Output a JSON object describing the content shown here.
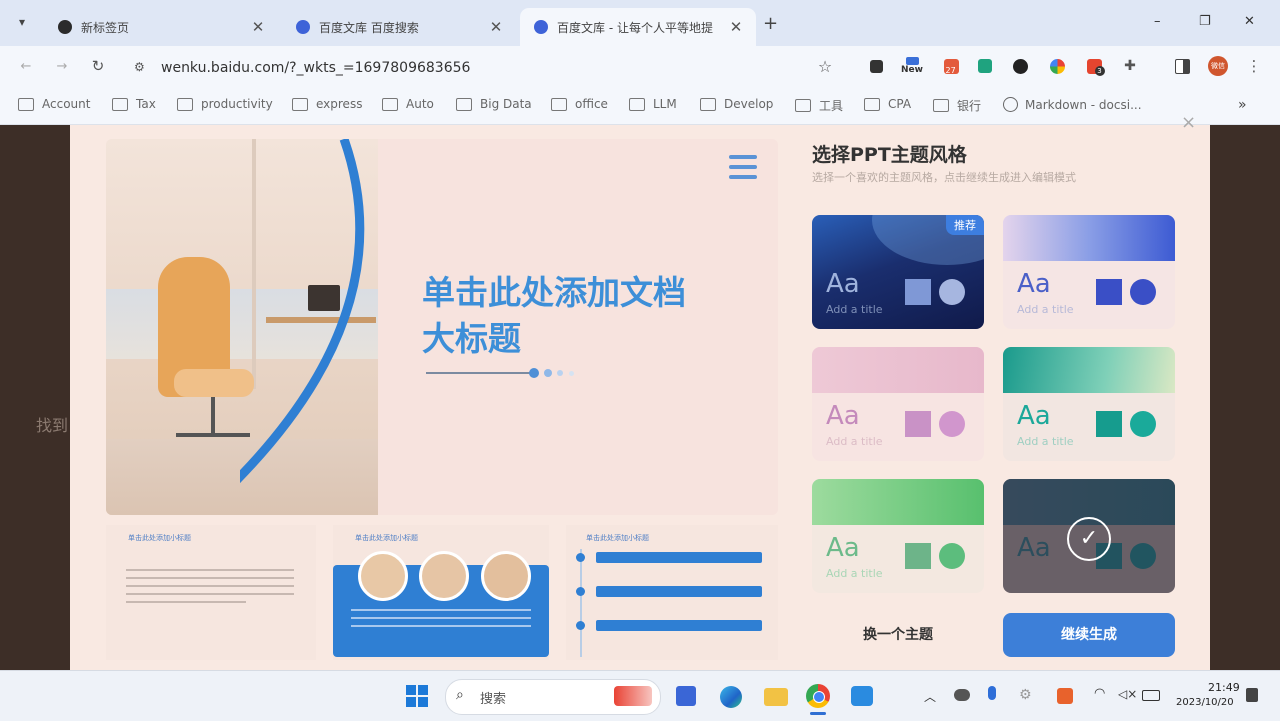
{
  "browser": {
    "tabs": [
      {
        "title": "新标签页",
        "active": false
      },
      {
        "title": "百度文库 百度搜索",
        "active": false
      },
      {
        "title": "百度文库 - 让每个人平等地提",
        "active": true
      }
    ],
    "new_tab_symbol": "+",
    "window_controls": [
      "–",
      "❐",
      "✕"
    ],
    "url": "wenku.baidu.com/?_wkts_=1697809683656",
    "extension_badges": {
      "new": "New",
      "count27": "27",
      "count3": "3"
    },
    "profile_initials": "微信"
  },
  "bookmarks": [
    "Account",
    "Tax",
    "productivity",
    "express",
    "Auto",
    "Big Data",
    "office",
    "LLM",
    "Develop",
    "工具",
    "CPA",
    "银行",
    "Markdown - docsi..."
  ],
  "bookmarks_more": "»",
  "slide": {
    "title_line1": "单击此处添加文档",
    "title_line2": "大标题"
  },
  "panel": {
    "close": "×",
    "title": "选择PPT主题风格",
    "subtitle": "选择一个喜欢的主题风格，点击继续生成进入编辑模式",
    "recommend_badge": "推荐",
    "themes": [
      {
        "aa": "Aa",
        "sub": "Add a title",
        "accent": "#5b78c6"
      },
      {
        "aa": "Aa",
        "sub": "Add a title",
        "accent": "#3a4fc6"
      },
      {
        "aa": "Aa",
        "sub": "Add a title",
        "accent": "#cc7fbf"
      },
      {
        "aa": "Aa",
        "sub": "Add a title",
        "accent": "#1ca89a"
      },
      {
        "aa": "Aa",
        "sub": "Add a title",
        "accent": "#5abf76"
      },
      {
        "aa": "Aa",
        "sub": "Add a title",
        "accent": "#1e6d7a"
      }
    ],
    "change_button": "换一个主题",
    "continue_button": "继续生成"
  },
  "thumbnails": {
    "heading": "单击此处添加小标题"
  },
  "taskbar": {
    "search_placeholder": "搜索",
    "time": "21:49",
    "date": "2023/10/20"
  },
  "side_text": "找到"
}
